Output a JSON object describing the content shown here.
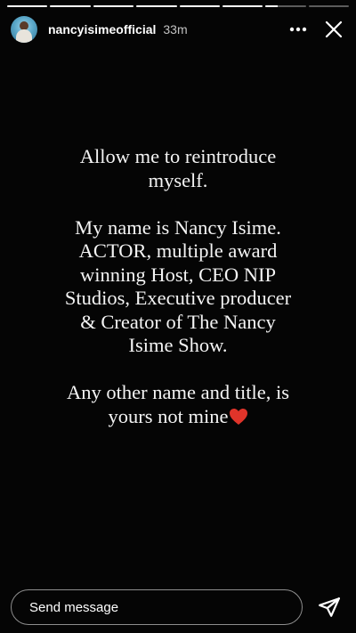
{
  "story": {
    "progress": [
      1,
      1,
      1,
      1,
      1,
      1,
      0.3,
      0
    ],
    "username": "nancyisimeofficial",
    "time": "33m",
    "text_lines": "Allow me to reintroduce\nmyself.\n\nMy name is Nancy Isime.\nACTOR, multiple award\nwinning Host, CEO NIP\nStudios, Executive producer\n& Creator of The Nancy\nIsime Show.\n\nAny other name and title, is\nyours not mine",
    "heart_emoji_color": "#e0342a"
  },
  "icons": {
    "more": "more-horizontal-icon",
    "close": "close-icon",
    "send": "send-paper-plane-icon",
    "heart": "red-heart-emoji"
  },
  "footer": {
    "placeholder": "Send message"
  },
  "colors": {
    "background": "#050505",
    "text": "#f4f4f4"
  }
}
